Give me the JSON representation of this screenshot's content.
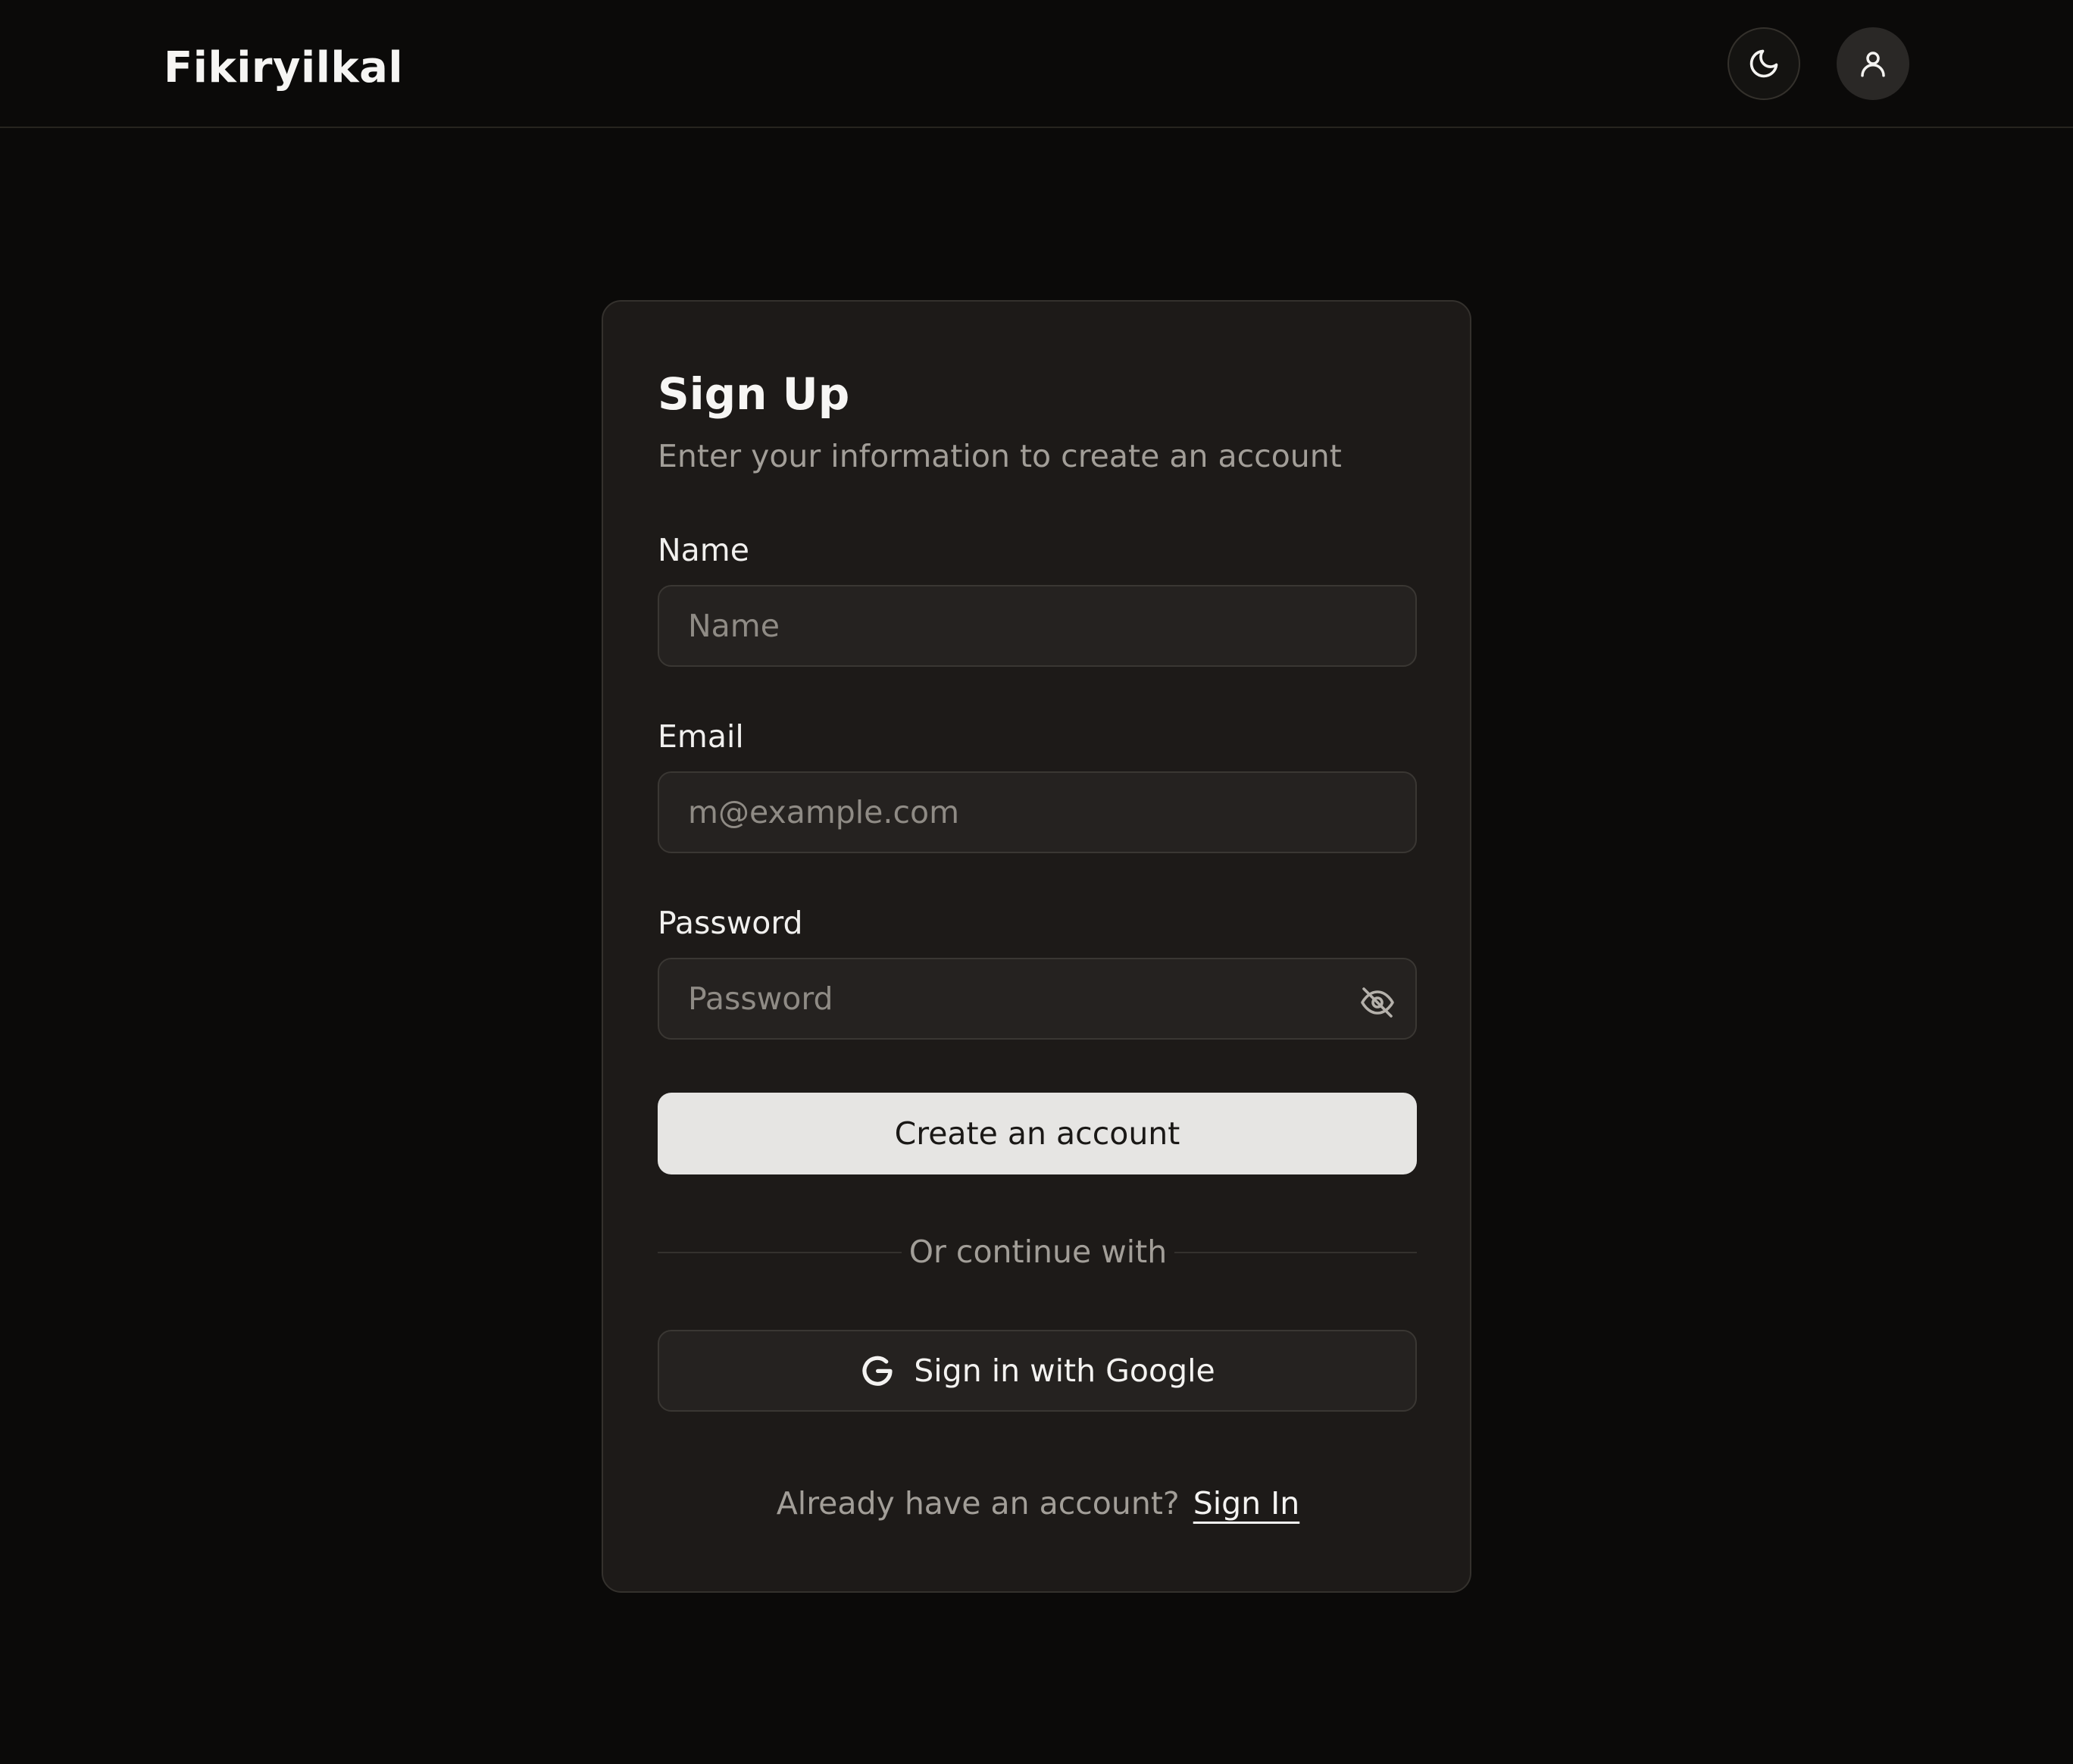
{
  "header": {
    "brand": "Fikiryilkal",
    "theme_icon": "moon-icon",
    "user_icon": "user-icon"
  },
  "card": {
    "title": "Sign Up",
    "subtitle": "Enter your information to create an account",
    "name": {
      "label": "Name",
      "placeholder": "Name",
      "value": ""
    },
    "email": {
      "label": "Email",
      "placeholder": "m@example.com",
      "value": ""
    },
    "password": {
      "label": "Password",
      "placeholder": "Password",
      "value": "",
      "toggle_icon": "eye-off-icon"
    },
    "submit_label": "Create an account",
    "divider_text": "Or continue with",
    "google_label": "Sign in with Google",
    "google_icon": "google-icon",
    "footer_text": "Already have an account?",
    "signin_link": "Sign In"
  },
  "colors": {
    "background": "#0b0a09",
    "card": "#1d1a18",
    "input": "#252220",
    "primary_button": "#e6e5e3",
    "muted_text": "#a29e98"
  }
}
